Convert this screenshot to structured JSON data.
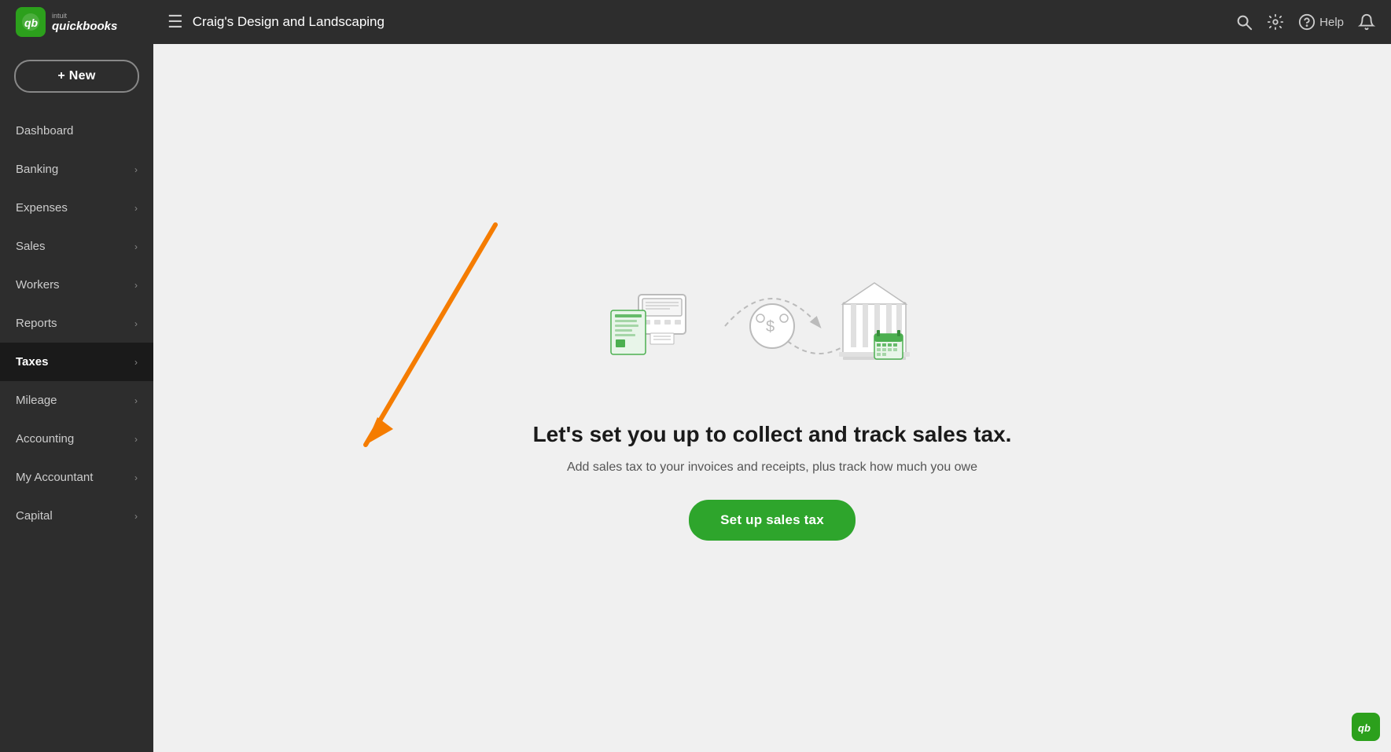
{
  "header": {
    "logo_intuit": "intuit",
    "logo_qb": "quickbooks",
    "hamburger": "☰",
    "company_name": "Craig's Design and Landscaping",
    "search_label": "search",
    "settings_label": "settings",
    "help_label": "Help",
    "notifications_label": "notifications"
  },
  "sidebar": {
    "new_button": "+ New",
    "items": [
      {
        "id": "dashboard",
        "label": "Dashboard",
        "has_chevron": false
      },
      {
        "id": "banking",
        "label": "Banking",
        "has_chevron": true
      },
      {
        "id": "expenses",
        "label": "Expenses",
        "has_chevron": true
      },
      {
        "id": "sales",
        "label": "Sales",
        "has_chevron": true
      },
      {
        "id": "workers",
        "label": "Workers",
        "has_chevron": true
      },
      {
        "id": "reports",
        "label": "Reports",
        "has_chevron": true
      },
      {
        "id": "taxes",
        "label": "Taxes",
        "has_chevron": true,
        "active": true
      },
      {
        "id": "mileage",
        "label": "Mileage",
        "has_chevron": true
      },
      {
        "id": "accounting",
        "label": "Accounting",
        "has_chevron": true
      },
      {
        "id": "my-accountant",
        "label": "My Accountant",
        "has_chevron": true
      },
      {
        "id": "capital",
        "label": "Capital",
        "has_chevron": true
      }
    ]
  },
  "main": {
    "title": "Let's set you up to collect and track sales tax.",
    "subtitle": "Add sales tax to your invoices and receipts, plus track how much you owe",
    "cta_button": "Set up sales tax"
  },
  "icons": {
    "search": "🔍",
    "settings": "⚙",
    "help_circle": "?",
    "bell": "🔔",
    "chevron_right": "›"
  }
}
